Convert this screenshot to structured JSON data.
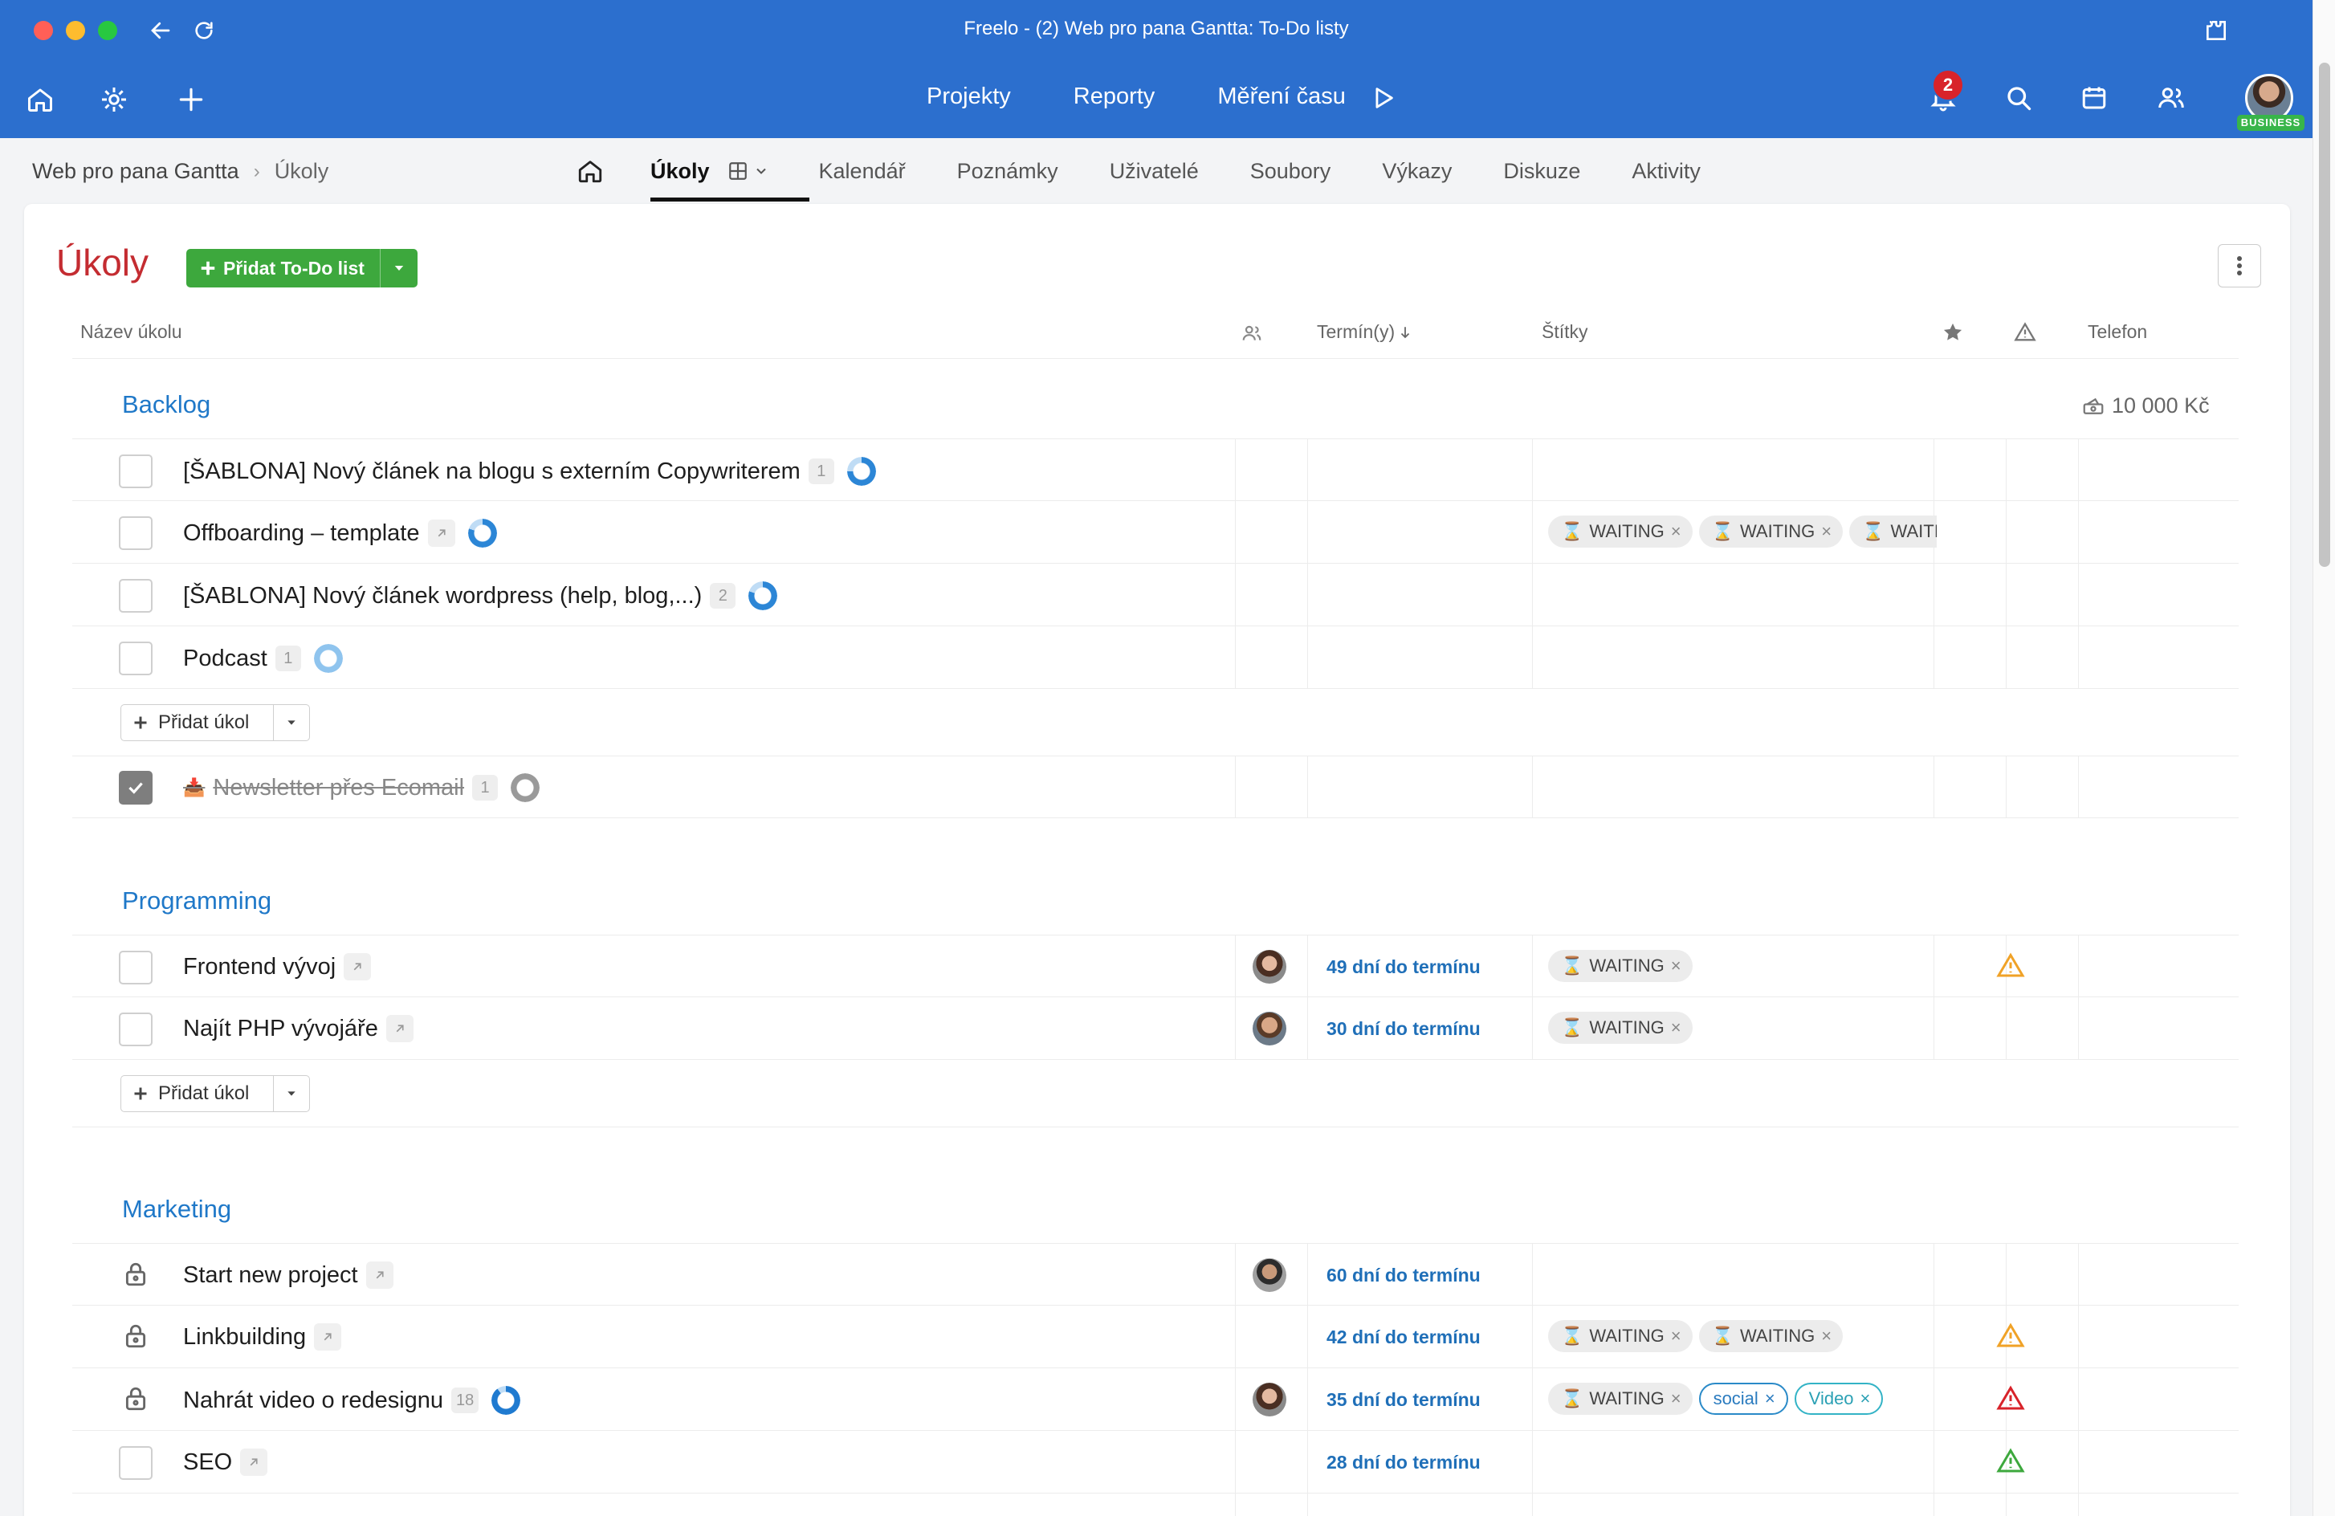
{
  "window": {
    "title": "Freelo - (2) Web pro pana Gantta: To-Do listy"
  },
  "topnav": {
    "links": [
      "Projekty",
      "Reporty",
      "Měření času"
    ],
    "notification_count": "2",
    "plan_badge": "BUSINESS"
  },
  "breadcrumb": {
    "project": "Web pro pana Gantta",
    "current": "Úkoly"
  },
  "tabs": [
    "Úkoly",
    "Kalendář",
    "Poznámky",
    "Uživatelé",
    "Soubory",
    "Výkazy",
    "Diskuze",
    "Aktivity"
  ],
  "page": {
    "title": "Úkoly",
    "add_list_label": "Přidat To-Do list"
  },
  "columns": {
    "name": "Název úkolu",
    "deadline": "Termín(y)",
    "tags": "Štítky",
    "phone": "Telefon"
  },
  "add_task_label": "Přidat úkol",
  "groups": [
    {
      "title": "Backlog",
      "budget": "10 000 Kč",
      "tasks": [
        {
          "name": "[ŠABLONA] Nový článek na blogu s externím Copywriterem",
          "count": "1",
          "progress": 0.75,
          "tags": []
        },
        {
          "name": "Offboarding – template",
          "progress": 0.8,
          "tags": [
            "WAITING",
            "WAITING",
            "WAITING"
          ]
        },
        {
          "name": "[ŠABLONA] Nový článek wordpress (help, blog,...)",
          "count": "2",
          "progress": 0.8,
          "tags": []
        },
        {
          "name": "Podcast",
          "count": "1",
          "progress": 0.0,
          "tags": []
        }
      ],
      "done_tasks": [
        {
          "name": "Newsletter přes Ecomail",
          "count": "1"
        }
      ]
    },
    {
      "title": "Programming",
      "tasks": [
        {
          "name": "Frontend vývoj",
          "deadline": "49 dní do termínu",
          "tags": [
            "WAITING"
          ],
          "warning": "orange"
        },
        {
          "name": "Najít PHP vývojáře",
          "deadline": "30 dní do termínu",
          "tags": [
            "WAITING"
          ]
        }
      ]
    },
    {
      "title": "Marketing",
      "tasks": [
        {
          "name": "Start new project",
          "deadline": "60 dní do termínu"
        },
        {
          "name": "Linkbuilding",
          "deadline": "42 dní do termínu",
          "tags": [
            "WAITING",
            "WAITING"
          ],
          "warning": "orange"
        },
        {
          "name": "Nahrát video o redesignu",
          "count": "18",
          "progress": 0.9,
          "deadline": "35 dní do termínu",
          "tags": [
            "WAITING",
            "social",
            "Video"
          ],
          "warning": "red"
        },
        {
          "name": "SEO",
          "deadline": "28 dní do termínu",
          "warning": "green"
        }
      ]
    }
  ],
  "colors": {
    "brand": "#2c6fce",
    "title_red": "#c42c31",
    "group_blue": "#1f78c8",
    "add_green": "#3da83d"
  }
}
